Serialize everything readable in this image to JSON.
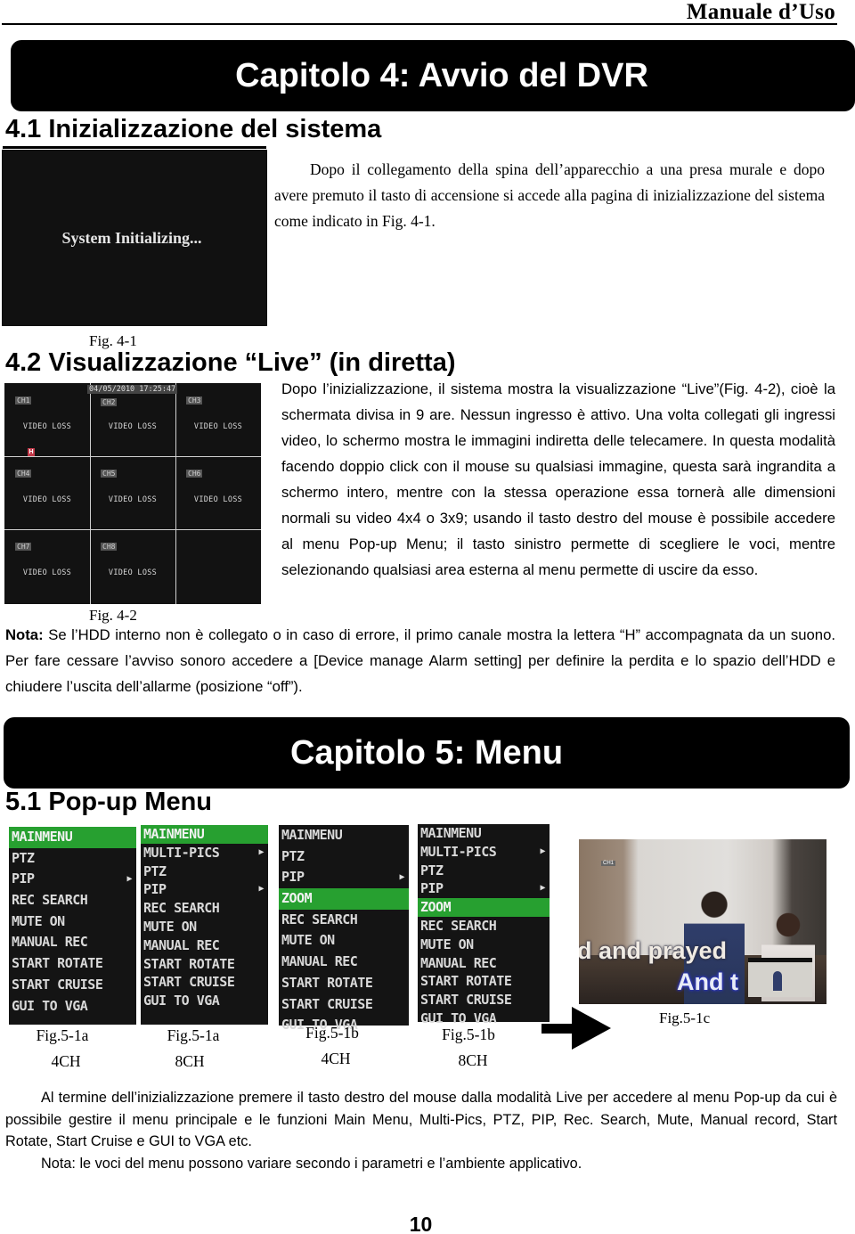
{
  "running_header": "Manuale  d’Uso",
  "chapter4": {
    "title": "Capitolo 4: Avvio del DVR",
    "section_41": {
      "title": "4.1 Inizializzazione del sistema",
      "figure_screen_text": "System Initializing...",
      "figure_caption": "Fig. 4-1",
      "paragraph": "Dopo il collegamento della spina dell’apparecchio a una presa murale e dopo avere premuto il tasto di accensione si accede alla pagina di inizializzazione del sistema come indicato in Fig. 4-1."
    },
    "section_42": {
      "title": "4.2 Visualizzazione “Live” (in diretta)",
      "paragraph": "Dopo l’inizializzazione, il sistema mostra la visualizzazione “Live”(Fig. 4-2), cioè la schermata divisa in 9 are. Nessun ingresso è attivo. Una volta collegati gli ingressi video, lo schermo mostra le immagini indiretta delle telecamere. In questa modalità facendo doppio click con il mouse su qualsiasi immagine, questa sarà ingrandita a schermo intero, mentre con la stessa operazione essa tornerà alle dimensioni normali su video 4x4 o 3x9; usando il tasto destro del mouse è possibile accedere al menu Pop-up Menu; il tasto sinistro permette di scegliere le voci, mentre selezionando qualsiasi area esterna al menu permette di uscire da esso.",
      "figure_caption": "Fig. 4-2",
      "live_view": {
        "timestamp": "04/05/2010 17:25:47",
        "hdd_indicator": "H",
        "channels": [
          {
            "label": "CH1",
            "status": "VIDEO LOSS"
          },
          {
            "label": "CH2",
            "status": "VIDEO LOSS"
          },
          {
            "label": "CH3",
            "status": "VIDEO LOSS"
          },
          {
            "label": "CH4",
            "status": "VIDEO LOSS"
          },
          {
            "label": "CH5",
            "status": "VIDEO LOSS"
          },
          {
            "label": "CH6",
            "status": "VIDEO LOSS"
          },
          {
            "label": "CH7",
            "status": "VIDEO LOSS"
          },
          {
            "label": "CH8",
            "status": "VIDEO LOSS"
          }
        ]
      },
      "note_label": "Nota:",
      "note_text": " Se l’HDD interno non è collegato o in caso di errore, il primo canale mostra la lettera “H” accompagnata da un suono. Per fare cessare l’avviso sonoro accedere a [Device manage   Alarm setting] per definire la perdita e lo spazio dell’HDD e chiudere l’uscita dell’allarme (posizione “off”)."
    }
  },
  "chapter5": {
    "title": "Capitolo 5: Menu",
    "section_51": {
      "title": "5.1 Pop-up Menu",
      "menus": [
        {
          "caption": "Fig.5-1a",
          "channels": "4CH",
          "items": [
            {
              "label": "MAINMENU",
              "active": true,
              "submenu": false
            },
            {
              "label": "PTZ",
              "active": false,
              "submenu": false
            },
            {
              "label": "PIP",
              "active": false,
              "submenu": true
            },
            {
              "label": "REC SEARCH",
              "active": false,
              "submenu": false
            },
            {
              "label": "MUTE ON",
              "active": false,
              "submenu": false
            },
            {
              "label": "MANUAL REC",
              "active": false,
              "submenu": false
            },
            {
              "label": "START ROTATE",
              "active": false,
              "submenu": false
            },
            {
              "label": "START CRUISE",
              "active": false,
              "submenu": false
            },
            {
              "label": "GUI TO VGA",
              "active": false,
              "submenu": false
            }
          ]
        },
        {
          "caption": "Fig.5-1a",
          "channels": "8CH",
          "items": [
            {
              "label": "MAINMENU",
              "active": true,
              "submenu": false
            },
            {
              "label": "MULTI-PICS",
              "active": false,
              "submenu": true
            },
            {
              "label": "PTZ",
              "active": false,
              "submenu": false
            },
            {
              "label": "PIP",
              "active": false,
              "submenu": true
            },
            {
              "label": "REC SEARCH",
              "active": false,
              "submenu": false
            },
            {
              "label": "MUTE ON",
              "active": false,
              "submenu": false
            },
            {
              "label": "MANUAL REC",
              "active": false,
              "submenu": false
            },
            {
              "label": "START ROTATE",
              "active": false,
              "submenu": false
            },
            {
              "label": "START CRUISE",
              "active": false,
              "submenu": false
            },
            {
              "label": "GUI TO VGA",
              "active": false,
              "submenu": false
            }
          ]
        },
        {
          "caption": "Fig.5-1b",
          "channels": "4CH",
          "items": [
            {
              "label": "MAINMENU",
              "active": false,
              "submenu": false
            },
            {
              "label": "PTZ",
              "active": false,
              "submenu": false
            },
            {
              "label": "PIP",
              "active": false,
              "submenu": true
            },
            {
              "label": "ZOOM",
              "active": true,
              "submenu": false
            },
            {
              "label": "REC SEARCH",
              "active": false,
              "submenu": false
            },
            {
              "label": "MUTE ON",
              "active": false,
              "submenu": false
            },
            {
              "label": "MANUAL REC",
              "active": false,
              "submenu": false
            },
            {
              "label": "START ROTATE",
              "active": false,
              "submenu": false
            },
            {
              "label": "START CRUISE",
              "active": false,
              "submenu": false
            },
            {
              "label": "GUI TO VGA",
              "active": false,
              "submenu": false
            }
          ]
        },
        {
          "caption": "Fig.5-1b",
          "channels": "8CH",
          "items": [
            {
              "label": "MAINMENU",
              "active": false,
              "submenu": false
            },
            {
              "label": "MULTI-PICS",
              "active": false,
              "submenu": true
            },
            {
              "label": "PTZ",
              "active": false,
              "submenu": false
            },
            {
              "label": "PIP",
              "active": false,
              "submenu": true
            },
            {
              "label": "ZOOM",
              "active": true,
              "submenu": false
            },
            {
              "label": "REC SEARCH",
              "active": false,
              "submenu": false
            },
            {
              "label": "MUTE ON",
              "active": false,
              "submenu": false
            },
            {
              "label": "MANUAL REC",
              "active": false,
              "submenu": false
            },
            {
              "label": "START ROTATE",
              "active": false,
              "submenu": false
            },
            {
              "label": "START CRUISE",
              "active": false,
              "submenu": false
            },
            {
              "label": "GUI TO VGA",
              "active": false,
              "submenu": false
            }
          ]
        }
      ],
      "zoom_figure": {
        "caption": "Fig.5-1c",
        "channel_tag": "CH1",
        "subtitle_line1": "d and prayed",
        "subtitle_line2": "And t"
      },
      "paragraph_line1": "Al termine dell’inizializzazione premere il tasto destro del mouse dalla modalità Live per accedere al menu Pop-up da cui è possibile gestire il menu principale e le funzioni Main Menu, Multi-Pics, PTZ, PIP, Rec. Search, Mute, Manual record, Start Rotate, Start Cruise e GUI to VGA etc.",
      "paragraph_note": "Nota: le voci del menu possono variare secondo i parametri e l’ambiente applicativo."
    }
  },
  "colors": {
    "menu_highlight": "#27a030",
    "menu_background": "#141414",
    "hdd_indicator": "#c23a4a"
  },
  "page_number": "10"
}
